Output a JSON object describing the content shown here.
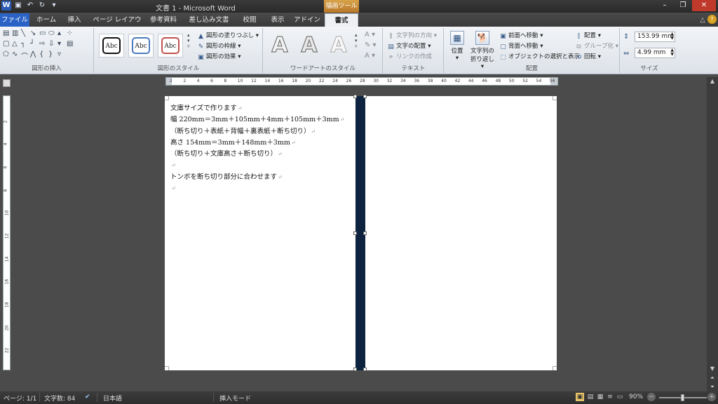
{
  "window": {
    "title": "文書 1 - Microsoft Word",
    "context_tab_group": "描画ツール"
  },
  "qat": {
    "word_icon": "W",
    "save_icon": "save-icon",
    "undo_icon": "↶",
    "redo_icon": "↻"
  },
  "window_controls": {
    "minimize": "–",
    "restore": "❐",
    "close": "✕"
  },
  "tabs": [
    "ファイル",
    "ホーム",
    "挿入",
    "ページ レイアウト",
    "参考資料",
    "差し込み文書",
    "校閲",
    "表示",
    "アドイン",
    "書式"
  ],
  "ribbon": {
    "groups": {
      "insert_shapes": "図形の挿入",
      "shape_styles": "図形のスタイル",
      "wordart_styles": "ワードアートのスタイル",
      "text": "テキスト",
      "arrange": "配置",
      "size": "サイズ"
    },
    "style_sample": "Abc",
    "shape_fill": "図形の塗りつぶし",
    "shape_outline": "図形の枠線",
    "shape_effects": "図形の効果",
    "wordart_sample": "A",
    "text_direction": "文字列の方向",
    "align_text": "文字の配置",
    "create_link": "リンクの作成",
    "position": "位置",
    "wrap_text_line1": "文字列の",
    "wrap_text_line2": "折り返し",
    "bring_forward": "前面へ移動",
    "send_backward": "背面へ移動",
    "selection_pane": "オブジェクトの選択と表示",
    "align": "配置",
    "group": "グループ化",
    "rotate": "回転",
    "height": "153.99 mm",
    "width": "4.99 mm"
  },
  "ruler": {
    "h_ticks": [
      "2",
      "2",
      "4",
      "6",
      "8",
      "10",
      "12",
      "14",
      "16",
      "18",
      "20",
      "22",
      "24",
      "26",
      "28",
      "30",
      "32",
      "34",
      "36",
      "38",
      "40",
      "42",
      "44",
      "46",
      "48",
      "50",
      "52",
      "54",
      "56"
    ],
    "v_ticks": [
      "2",
      "4",
      "6",
      "8",
      "10",
      "12",
      "14",
      "16",
      "18",
      "20",
      "22"
    ]
  },
  "document": {
    "lines": [
      "文庫サイズで作ります",
      "幅 220mm＝3mm＋105mm＋4mm＋105mm＋3mm",
      "（断ち切り＋表紙＋背幅＋裏表紙＋断ち切り）",
      "高さ 154mm＝3mm＋148mm＋3mm",
      "（断ち切り＋文庫高さ＋断ち切り）",
      "",
      "トンボを断ち切り部分に合わせます",
      ""
    ],
    "paragraph_mark": "↵",
    "spine_color": "#0e2340"
  },
  "status": {
    "page": "ページ: 1/1",
    "word_count": "文字数: 84",
    "language": "日本語",
    "insert_mode": "挿入モード",
    "zoom": "90%",
    "zoom_value": 0.45
  }
}
